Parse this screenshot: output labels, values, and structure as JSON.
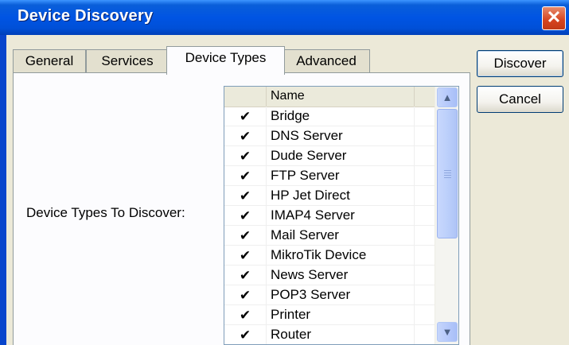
{
  "window": {
    "title": "Device Discovery",
    "close_glyph": "✕"
  },
  "tabs": [
    {
      "label": "General",
      "active": false
    },
    {
      "label": "Services",
      "active": false
    },
    {
      "label": "Device Types",
      "active": true
    },
    {
      "label": "Advanced",
      "active": false
    }
  ],
  "form": {
    "label": "Device Types To Discover:"
  },
  "list": {
    "columns": {
      "check": "",
      "name": "Name",
      "extra": ""
    },
    "sort_indicator": "▲",
    "rows": [
      {
        "checked": "✔",
        "name": "Bridge"
      },
      {
        "checked": "✔",
        "name": "DNS Server"
      },
      {
        "checked": "✔",
        "name": "Dude Server"
      },
      {
        "checked": "✔",
        "name": "FTP Server"
      },
      {
        "checked": "✔",
        "name": "HP Jet Direct"
      },
      {
        "checked": "✔",
        "name": "IMAP4 Server"
      },
      {
        "checked": "✔",
        "name": "Mail Server"
      },
      {
        "checked": "✔",
        "name": "MikroTik Device"
      },
      {
        "checked": "✔",
        "name": "News Server"
      },
      {
        "checked": "✔",
        "name": "POP3 Server"
      },
      {
        "checked": "✔",
        "name": "Printer"
      },
      {
        "checked": "✔",
        "name": "Router"
      }
    ],
    "scroll_up_glyph": "▲",
    "scroll_down_glyph": "▼"
  },
  "buttons": {
    "discover": "Discover",
    "cancel": "Cancel"
  },
  "colors": {
    "titlebar": "#0054e3",
    "dialog_bg": "#ece9d8",
    "close_button": "#d6431f",
    "button_border": "#003c74"
  }
}
